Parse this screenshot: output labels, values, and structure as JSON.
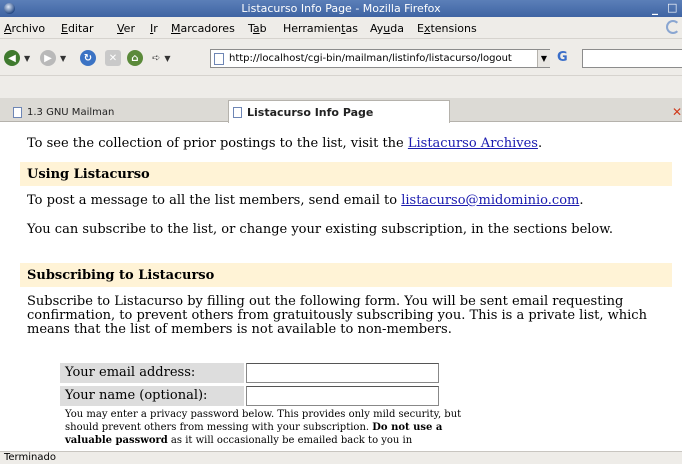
{
  "window": {
    "title": "Listacurso Info Page - Mozilla Firefox",
    "min_glyph": "_",
    "max_glyph": "□"
  },
  "menu": {
    "items": [
      {
        "pre": "",
        "u": "A",
        "post": "rchivo"
      },
      {
        "pre": "",
        "u": "E",
        "post": "ditar"
      },
      {
        "pre": "",
        "u": "V",
        "post": "er"
      },
      {
        "pre": "",
        "u": "I",
        "post": "r"
      },
      {
        "pre": "",
        "u": "M",
        "post": "arcadores"
      },
      {
        "pre": "T",
        "u": "a",
        "post": "b"
      },
      {
        "pre": "Herramien",
        "u": "t",
        "post": "as"
      },
      {
        "pre": "Ay",
        "u": "u",
        "post": "da"
      },
      {
        "pre": "E",
        "u": "x",
        "post": "tensions"
      }
    ]
  },
  "toolbar": {
    "url": "http://localhost/cgi-bin/mailman/listinfo/listacurso/logout",
    "go_glyph": "G"
  },
  "tabs": [
    {
      "label": "1.3 GNU Mailman",
      "active": false
    },
    {
      "label": "Listacurso Info Page",
      "active": true
    }
  ],
  "content": {
    "archives_pre": "To see the collection of prior postings to the list, visit the ",
    "archives_link": "Listacurso Archives",
    "archives_post": ".",
    "section_using": "Using Listacurso",
    "post_pre": "To post a message to all the list members, send email to ",
    "post_link": "listacurso@midominio.com",
    "post_post": ".",
    "subscribe_intro": "You can subscribe to the list, or change your existing subscription, in the sections below.",
    "section_subscribing": "Subscribing to Listacurso",
    "subscribe_text": "Subscribe to Listacurso by filling out the following form. You will be sent email requesting confirmation, to prevent others from gratuitously subscribing you. This is a private list, which means that the list of members is not available to non-members.",
    "email_label": "Your email address:",
    "email_value": "",
    "name_label": "Your name (optional):",
    "name_value": "",
    "privacy_pre": "You may enter a privacy password below. This provides only mild security, but should prevent others from messing with your subscription. ",
    "privacy_bold": "Do not use a valuable password",
    "privacy_post": " as it will occasionally be emailed back to you in"
  },
  "status": {
    "text": "Terminado"
  },
  "colors": {
    "titlebar": "#4a6fad",
    "section_bg": "#fff3d6",
    "link": "#1a1aaf"
  }
}
